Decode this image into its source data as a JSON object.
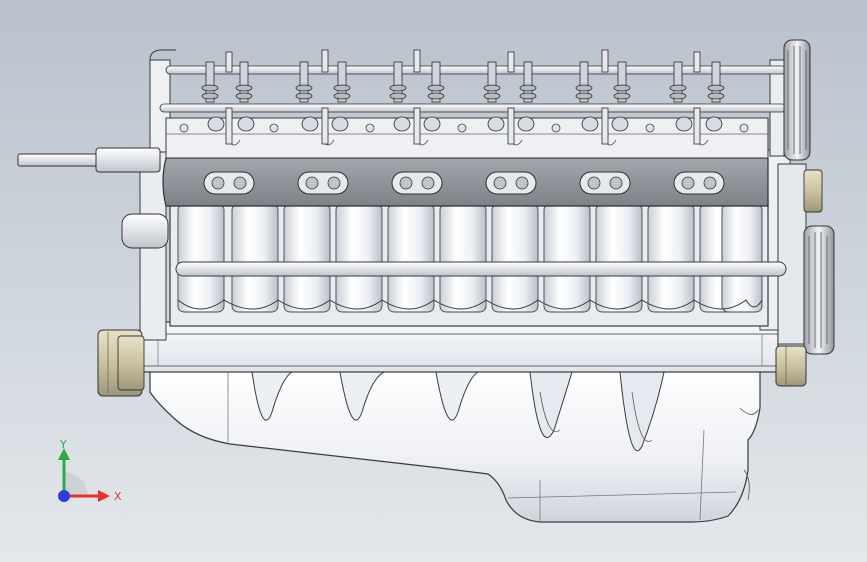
{
  "viewport": {
    "background_top": "#b9c1cb",
    "background_bottom": "#e4e8ec"
  },
  "model": {
    "subject": "v12-engine-side-view",
    "cylinders_per_bank_visible": 6,
    "body_color": "#f2f4f8",
    "edge_color": "#3a3a3a",
    "shade_color": "#c4c9d2",
    "head_color": "#8e9198",
    "brass_color": "#cfc6a6"
  },
  "triad": {
    "x_label": "X",
    "y_label": "Y",
    "x_color": "#e0342a",
    "y_color": "#2fa84a",
    "z_color": "#2a3fd8"
  }
}
